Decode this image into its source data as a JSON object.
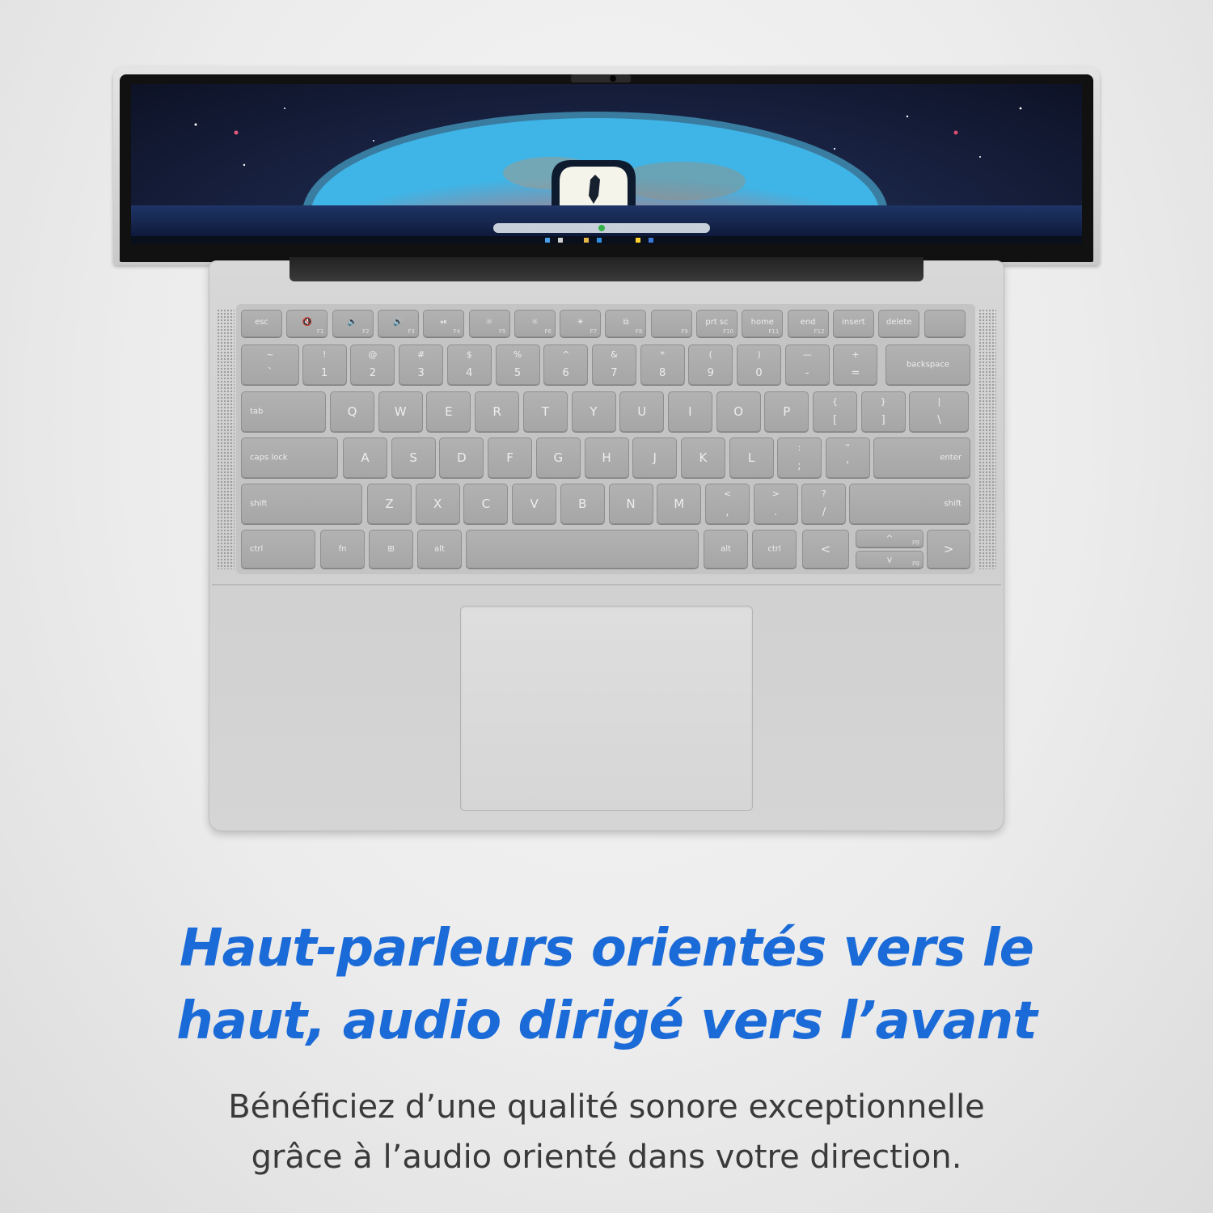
{
  "headline": {
    "line1": "Haut-parleurs orientés vers le",
    "line2": "haut, audio dirigé vers l’avant",
    "color": "#1a6ad8"
  },
  "subtext": {
    "line1": "Bénéficiez d’une qualité sonore exceptionnelle",
    "line2": "grâce à l’audio orienté dans votre direction."
  },
  "laptop": {
    "wallpaper": "moon-and-door-wallpaper",
    "taskbar_icons": [
      "windows-icon",
      "search-icon",
      "files-icon",
      "browser-icon",
      "store-icon",
      "mail-icon"
    ]
  },
  "keyboard": {
    "function_row": [
      {
        "main": "esc",
        "fn": ""
      },
      {
        "main": "🔇",
        "fn": "F1"
      },
      {
        "main": "🔉",
        "fn": "F2"
      },
      {
        "main": "🔊",
        "fn": "F3"
      },
      {
        "main": "⏯",
        "fn": "F4"
      },
      {
        "main": "☼",
        "fn": "F5"
      },
      {
        "main": "☼",
        "fn": "F6"
      },
      {
        "main": "☀",
        "fn": "F7"
      },
      {
        "main": "⧉",
        "fn": "F8"
      },
      {
        "main": "",
        "fn": "F9"
      },
      {
        "main": "prt sc",
        "fn": "F10"
      },
      {
        "main": "home",
        "fn": "F11"
      },
      {
        "main": "end",
        "fn": "F12"
      },
      {
        "main": "insert",
        "fn": ""
      },
      {
        "main": "delete",
        "fn": ""
      },
      {
        "main": "",
        "fn": ""
      }
    ],
    "number_row": [
      {
        "top": "~",
        "bot": "`"
      },
      {
        "top": "!",
        "bot": "1"
      },
      {
        "top": "@",
        "bot": "2"
      },
      {
        "top": "#",
        "bot": "3"
      },
      {
        "top": "$",
        "bot": "4"
      },
      {
        "top": "%",
        "bot": "5"
      },
      {
        "top": "^",
        "bot": "6"
      },
      {
        "top": "&",
        "bot": "7"
      },
      {
        "top": "*",
        "bot": "8"
      },
      {
        "top": "(",
        "bot": "9"
      },
      {
        "top": ")",
        "bot": "0"
      },
      {
        "top": "—",
        "bot": "-"
      },
      {
        "top": "+",
        "bot": "="
      }
    ],
    "backspace": "backspace",
    "tab": "tab",
    "qwerty_row": [
      "Q",
      "W",
      "E",
      "R",
      "T",
      "Y",
      "U",
      "I",
      "O",
      "P"
    ],
    "bracket_keys": [
      {
        "top": "{",
        "bot": "["
      },
      {
        "top": "}",
        "bot": "]"
      },
      {
        "top": "|",
        "bot": "\\"
      }
    ],
    "caps_lock": "caps lock",
    "home_row": [
      "A",
      "S",
      "D",
      "F",
      "G",
      "H",
      "J",
      "K",
      "L"
    ],
    "home_punct": [
      {
        "top": ":",
        "bot": ";"
      },
      {
        "top": "“",
        "bot": "‘"
      }
    ],
    "enter": "enter",
    "shift": "shift",
    "bottom_letters": [
      "Z",
      "X",
      "C",
      "V",
      "B",
      "N",
      "M"
    ],
    "bottom_punct": [
      {
        "top": "<",
        "bot": ","
      },
      {
        "top": ">",
        "bot": "."
      },
      {
        "top": "?",
        "bot": "/"
      }
    ],
    "ctrl": "ctrl",
    "fn": "fn",
    "windows_key": "⊞",
    "alt": "alt",
    "arrow_left": "<",
    "arrow_right": ">",
    "arrow_up": "^",
    "arrow_down": "v",
    "pg": "pg"
  }
}
